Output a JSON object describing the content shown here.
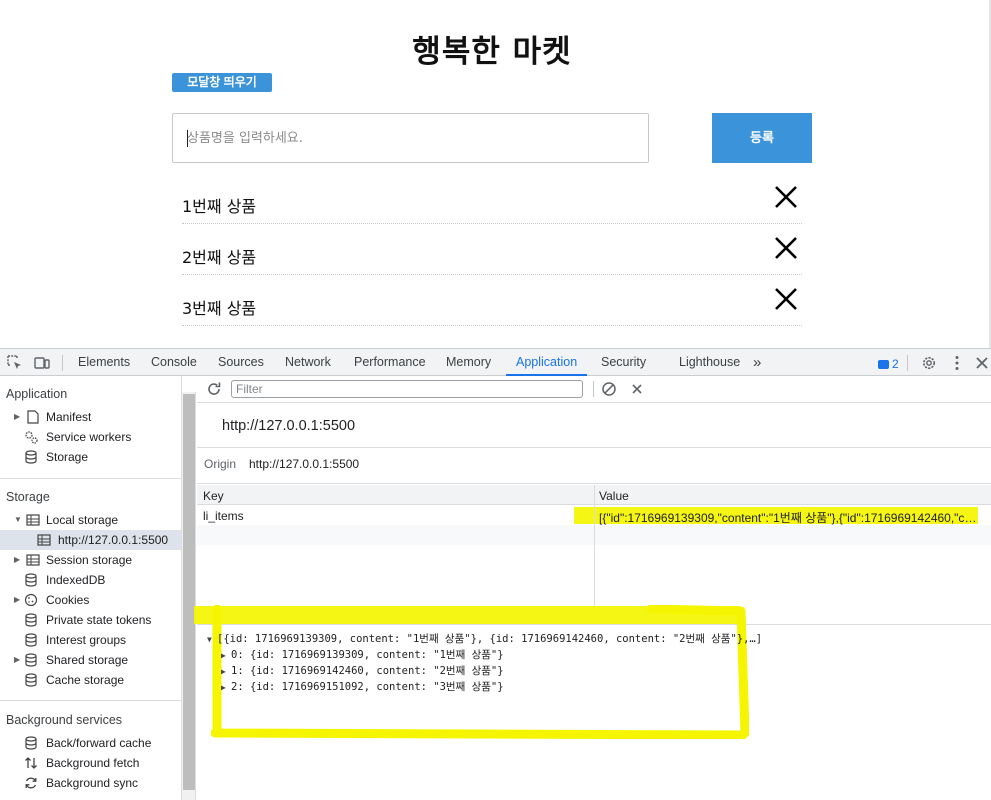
{
  "app": {
    "title": "행복한 마켓",
    "modal_button": "모달창 띄우기",
    "input_placeholder": "상품명을 입력하세요.",
    "submit_button": "등록",
    "items": [
      {
        "label": "1번째 상품"
      },
      {
        "label": "2번째 상품"
      },
      {
        "label": "3번째 상품"
      }
    ]
  },
  "devtools": {
    "tabs": [
      "Elements",
      "Console",
      "Sources",
      "Network",
      "Performance",
      "Memory",
      "Application",
      "Security",
      "Lighthouse"
    ],
    "active_tab": "Application",
    "more_tabs": "»",
    "issues_count": "2",
    "sidebar": {
      "application_title": "Application",
      "application_items": [
        "Manifest",
        "Service workers",
        "Storage"
      ],
      "storage_title": "Storage",
      "local_storage": "Local storage",
      "local_storage_origin": "http://127.0.0.1:5500",
      "storage_items": [
        "Session storage",
        "IndexedDB",
        "Cookies",
        "Private state tokens",
        "Interest groups",
        "Shared storage",
        "Cache storage"
      ],
      "background_title": "Background services",
      "background_items": [
        "Back/forward cache",
        "Background fetch",
        "Background sync"
      ]
    },
    "filter_placeholder": "Filter",
    "origin_header": "http://127.0.0.1:5500",
    "origin_label": "Origin",
    "origin_value": "http://127.0.0.1:5500",
    "table": {
      "col_key": "Key",
      "col_value": "Value",
      "rows": [
        {
          "key": "li_items",
          "value": "[{\"id\":1716969139309,\"content\":\"1번째 상품\"},{\"id\":1716969142460,\"content\":\"2번째 상품\"},{\"id\":1716969151092,\"content\":\"3번째 상품\"}]"
        }
      ]
    },
    "preview": {
      "summary": "[{id: 1716969139309, content: \"1번째 상품\"}, {id: 1716969142460, content: \"2번째 상품\"},…]",
      "entries": [
        "0: {id: 1716969139309, content: \"1번째 상품\"}",
        "1: {id: 1716969142460, content: \"2번째 상품\"}",
        "2: {id: 1716969151092, content: \"3번째 상품\"}"
      ]
    },
    "colors": {
      "accent": "#1a73e8",
      "highlight": "#f5f500",
      "app_button": "#3b93d9"
    }
  }
}
